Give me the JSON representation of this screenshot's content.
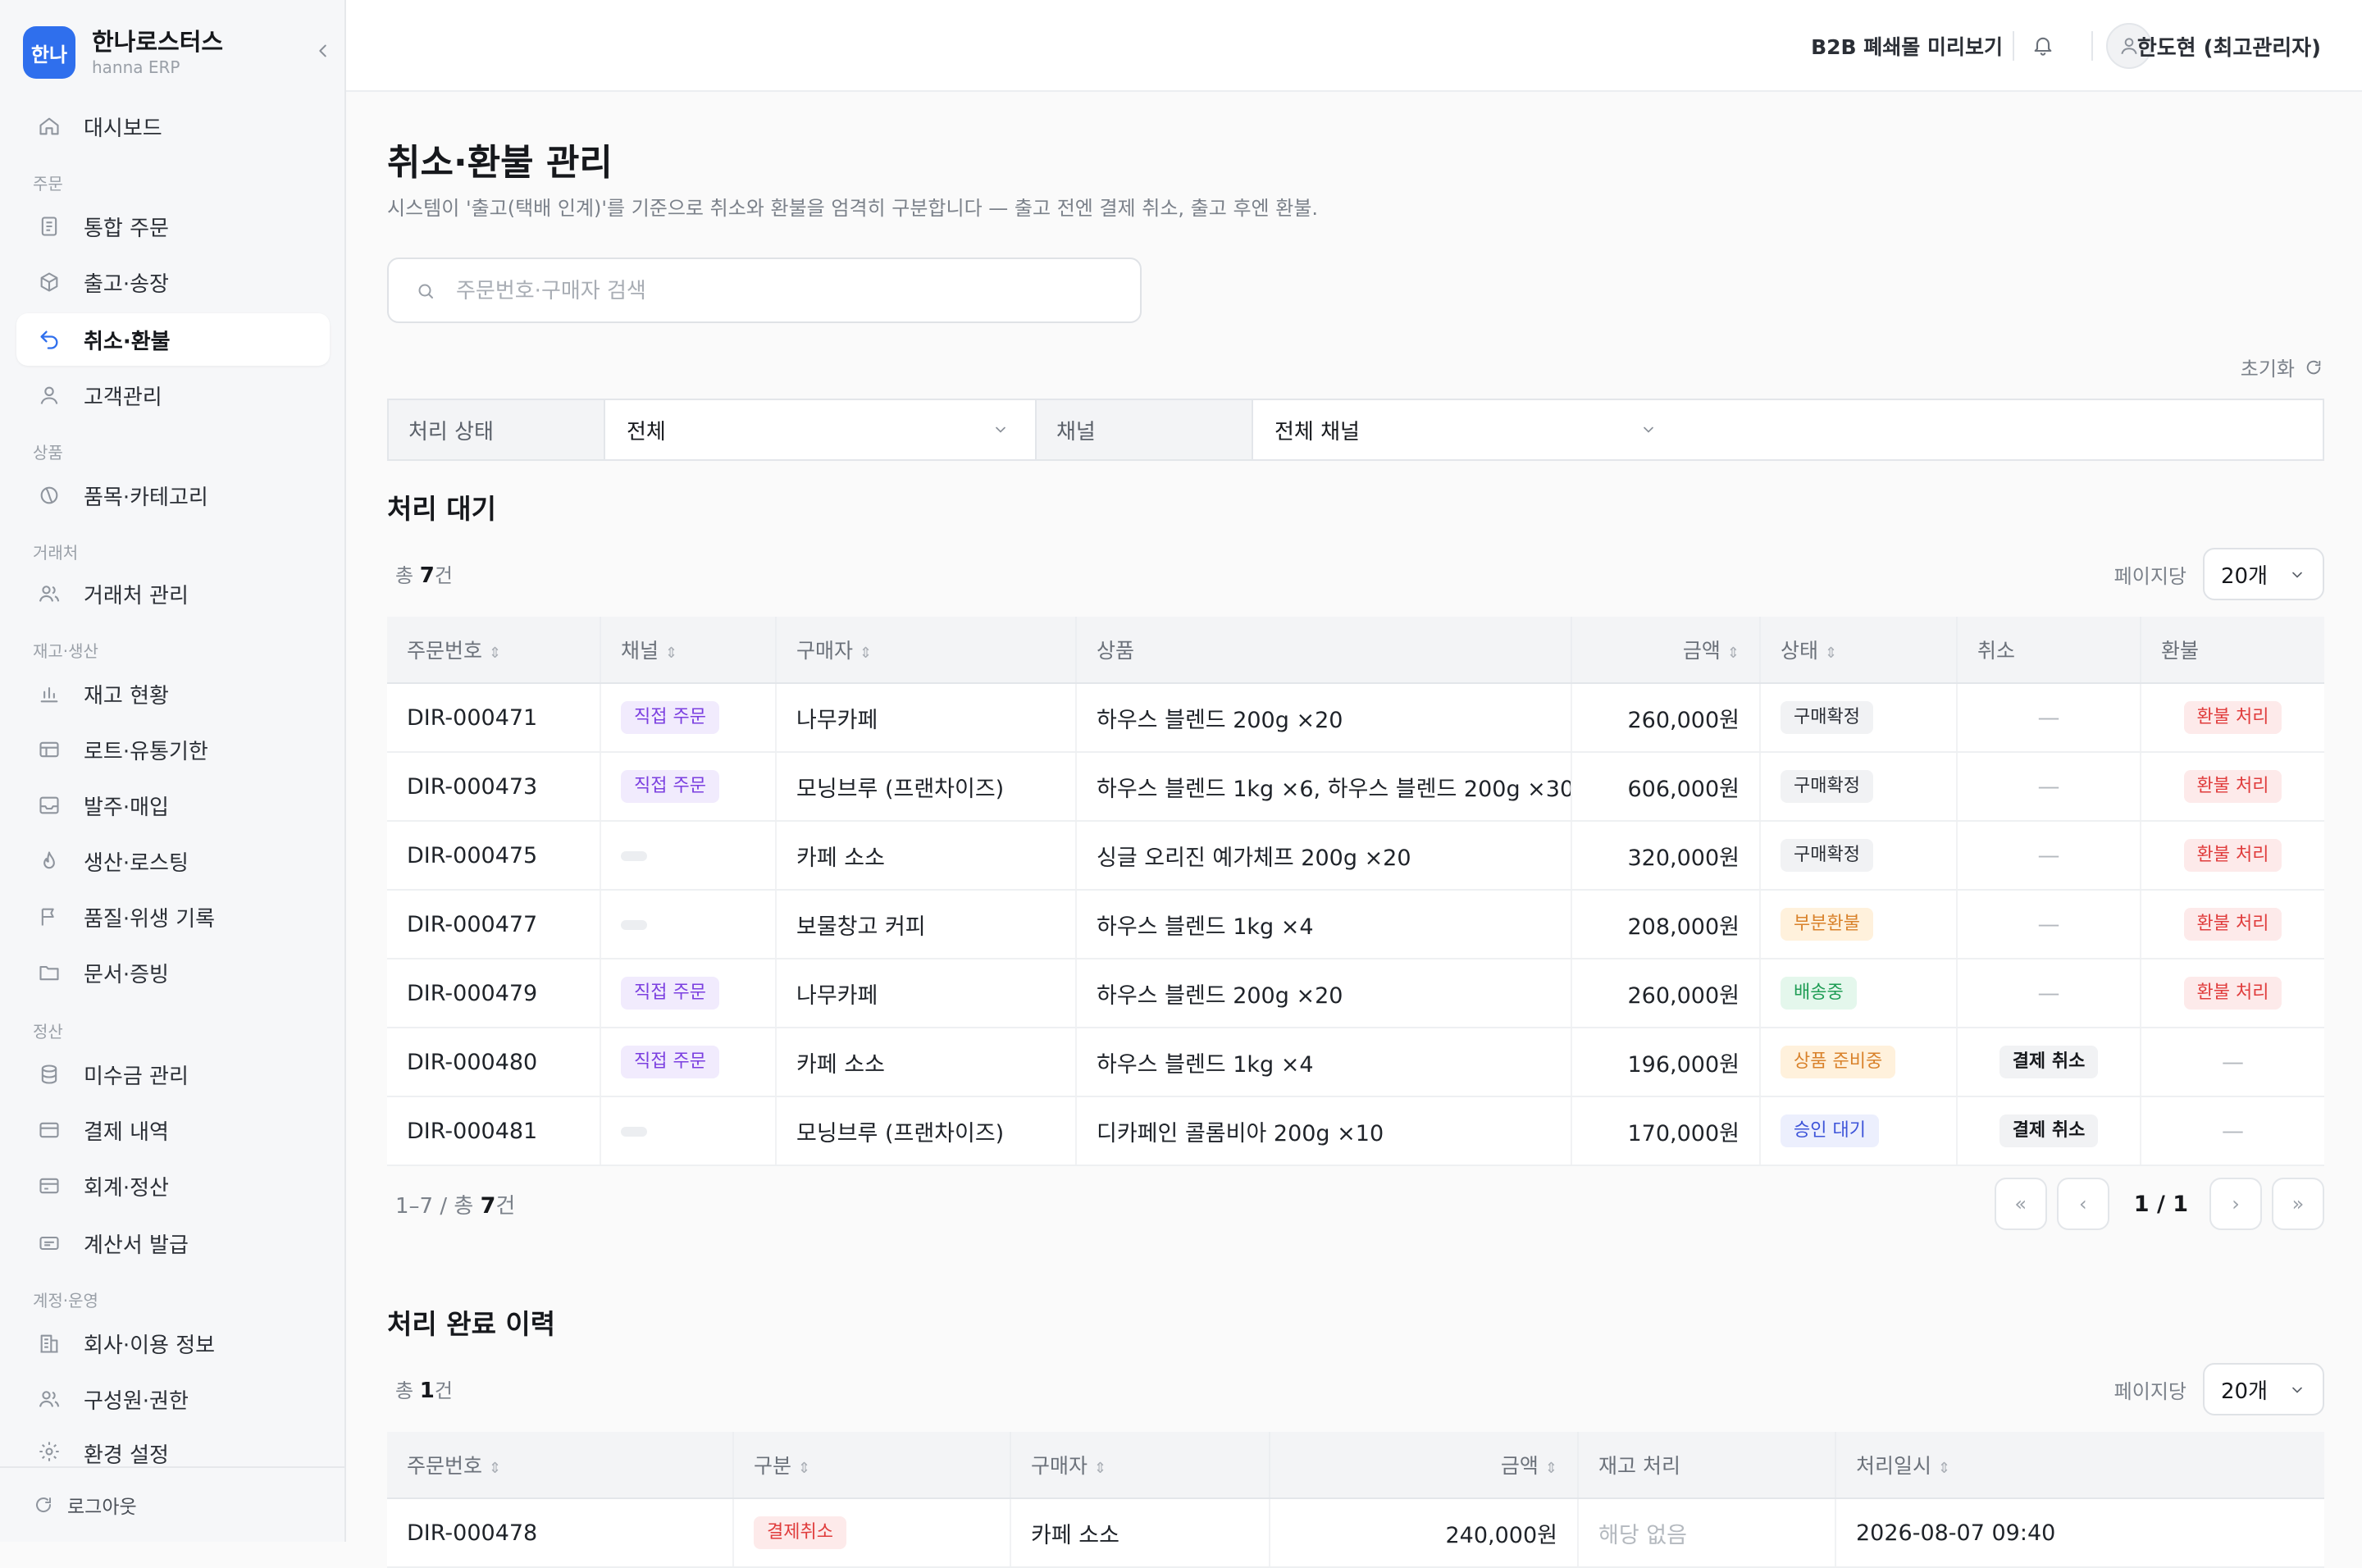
{
  "brand": {
    "logo": "한나",
    "name": "한나로스터스",
    "sub": "hanna ERP"
  },
  "sidebar": {
    "dashboard": "대시보드",
    "sections": {
      "order": "주문",
      "product": "상품",
      "partner": "거래처",
      "stock": "재고·생산",
      "settle": "정산",
      "account": "계정·운영"
    },
    "items": {
      "orders": "통합 주문",
      "shipping": "출고·송장",
      "refund": "취소·환불",
      "customers": "고객관리",
      "catalog": "품목·카테고리",
      "partners": "거래처 관리",
      "inventory": "재고 현황",
      "lots": "로트·유통기한",
      "purchase": "발주·매입",
      "roasting": "생산·로스팅",
      "quality": "품질·위생 기록",
      "docs": "문서·증빙",
      "receivable": "미수금 관리",
      "payments": "결제 내역",
      "accounting": "회계·정산",
      "invoice": "계산서 발급",
      "company": "회사·이용 정보",
      "members": "구성원·권한",
      "settings": "환경 설정"
    },
    "logout": "로그아웃"
  },
  "header": {
    "preview": "B2B 폐쇄몰 미리보기",
    "user": "한도현 (최고관리자)"
  },
  "page": {
    "title": "취소·환불 관리",
    "desc": "시스템이 '출고(택배 인계)'를 기준으로 취소와 환불을 엄격히 구분합니다 — 출고 전엔 결제 취소, 출고 후엔 환불.",
    "search_placeholder": "주문번호·구매자 검색",
    "reset": "초기화"
  },
  "filters": {
    "status_label": "처리 상태",
    "status_value": "전체",
    "channel_label": "채널",
    "channel_value": "전체 채널"
  },
  "pending": {
    "title": "처리 대기",
    "total_prefix": "총 ",
    "total_count": "7",
    "total_suffix": "건",
    "perpage_label": "페이지당",
    "perpage_value": "20개",
    "columns": [
      "주문번호",
      "채널",
      "구매자",
      "상품",
      "금액",
      "상태",
      "취소",
      "환불"
    ],
    "rows": [
      {
        "id": "DIR-000471",
        "channel": "직접 주문",
        "buyer": "나무카페",
        "product": "하우스 블렌드 200g ×20",
        "amount": "260,000원",
        "status": "구매확정",
        "cancel": "—",
        "refund": "환불 처리"
      },
      {
        "id": "DIR-000473",
        "channel": "직접 주문",
        "buyer": "모닝브루 (프랜차이즈)",
        "product": "하우스 블렌드 1kg ×6, 하우스 블렌드 200g ×30",
        "amount": "606,000원",
        "status": "구매확정",
        "cancel": "—",
        "refund": "환불 처리"
      },
      {
        "id": "DIR-000475",
        "channel": "",
        "buyer": "카페 소소",
        "product": "싱글 오리진 예가체프 200g ×20",
        "amount": "320,000원",
        "status": "구매확정",
        "cancel": "—",
        "refund": "환불 처리"
      },
      {
        "id": "DIR-000477",
        "channel": "",
        "buyer": "보물창고 커피",
        "product": "하우스 블렌드 1kg ×4",
        "amount": "208,000원",
        "status": "부분환불",
        "cancel": "—",
        "refund": "환불 처리"
      },
      {
        "id": "DIR-000479",
        "channel": "직접 주문",
        "buyer": "나무카페",
        "product": "하우스 블렌드 200g ×20",
        "amount": "260,000원",
        "status": "배송중",
        "cancel": "—",
        "refund": "환불 처리"
      },
      {
        "id": "DIR-000480",
        "channel": "직접 주문",
        "buyer": "카페 소소",
        "product": "하우스 블렌드 1kg ×4",
        "amount": "196,000원",
        "status": "상품 준비중",
        "cancel": "결제 취소",
        "refund": "—"
      },
      {
        "id": "DIR-000481",
        "channel": "",
        "buyer": "모닝브루 (프랜차이즈)",
        "product": "디카페인 콜롬비아 200g ×10",
        "amount": "170,000원",
        "status": "승인 대기",
        "cancel": "결제 취소",
        "refund": "—"
      }
    ],
    "range": "1–7 / 총 ",
    "range_count": "7",
    "range_suffix": "건",
    "page": "1 / 1"
  },
  "done": {
    "title": "처리 완료 이력",
    "total_prefix": "총 ",
    "total_count": "1",
    "total_suffix": "건",
    "perpage_label": "페이지당",
    "perpage_value": "20개",
    "columns": [
      "주문번호",
      "구분",
      "구매자",
      "금액",
      "재고 처리",
      "처리일시"
    ],
    "rows": [
      {
        "id": "DIR-000478",
        "type": "결제취소",
        "buyer": "카페 소소",
        "amount": "240,000원",
        "stock": "해당 없음",
        "date": "2026-08-07 09:40"
      }
    ]
  },
  "colors": {
    "accent": "#2f6fed",
    "refund": "#e03c3c",
    "direct": "#7b3fe0"
  },
  "icons": [
    "home-icon",
    "doc-icon",
    "box-icon",
    "undo-icon",
    "user-icon",
    "leaf-icon",
    "handshake-icon",
    "chart-icon",
    "table-icon",
    "inbox-icon",
    "flame-icon",
    "flag-icon",
    "folder-icon",
    "database-icon",
    "card-icon",
    "receipt-icon",
    "building-icon",
    "users-icon",
    "gear-icon",
    "refresh-icon",
    "bell-icon",
    "search-icon",
    "chevron-down-icon",
    "chevron-left-icon"
  ]
}
